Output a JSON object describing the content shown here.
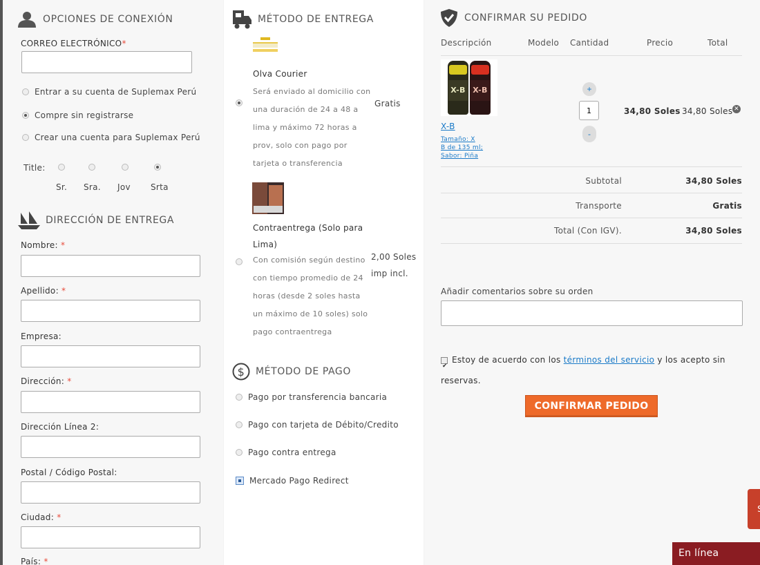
{
  "login": {
    "title": "OPCIONES DE CONEXIÓN",
    "email_label": "CORREO ELECTRÓNICO",
    "email_required": "*",
    "email_value": "",
    "options": [
      {
        "label": "Entrar a su cuenta de Suplemax Perú",
        "checked": false
      },
      {
        "label": "Compre sin registrarse",
        "checked": true
      },
      {
        "label": "Crear una cuenta para Suplemax Perú",
        "checked": false
      }
    ],
    "title_label": "Title:",
    "titles": [
      {
        "label": "Sr.",
        "checked": false
      },
      {
        "label": "Sra.",
        "checked": false
      },
      {
        "label": "Jov",
        "checked": false
      },
      {
        "label": "Srta",
        "checked": true
      }
    ]
  },
  "address": {
    "title": "DIRECCIÓN DE ENTREGA",
    "fields": [
      {
        "label": "Nombre:",
        "required": "*"
      },
      {
        "label": "Apellido:",
        "required": "*"
      },
      {
        "label": "Empresa:",
        "required": ""
      },
      {
        "label": "Dirección:",
        "required": "*"
      },
      {
        "label": "Dirección Línea 2:",
        "required": ""
      },
      {
        "label": "Postal / Código Postal:",
        "required": ""
      },
      {
        "label": "Ciudad:",
        "required": "*"
      },
      {
        "label": "País:",
        "required": "*"
      }
    ]
  },
  "shipping": {
    "title": "MÉTODO DE ENTREGA",
    "methods": [
      {
        "name": "Olva Courier",
        "lines": [
          "Será enviado al domicilio con",
          "una duración de 24 a 48 a",
          "lima y máximo 72 horas a",
          "prov, solo con pago por",
          "tarjeta o transferencia"
        ],
        "price_1": "Gratis",
        "price_2": "",
        "checked": true
      },
      {
        "name_1": "Contraentrega (Solo para",
        "name_2": "Lima)",
        "lines": [
          "Con comisión según destino",
          "con tiempo promedio de 24",
          "horas (desde 2 soles hasta",
          "un máximo de 10 soles) solo",
          "pago contraentrega"
        ],
        "price_1": "2,00 Soles",
        "price_2": "imp incl.",
        "checked": false
      }
    ]
  },
  "payment": {
    "title": "MÉTODO DE PAGO",
    "methods": [
      {
        "label": "Pago por transferencia bancaria",
        "checked": false
      },
      {
        "label": "Pago con tarjeta de Débito/Credito",
        "checked": false
      },
      {
        "label": "Pago contra entrega",
        "checked": false
      },
      {
        "label": "Mercado Pago Redirect",
        "checked": true
      }
    ]
  },
  "order": {
    "title": "CONFIRMAR SU PEDIDO",
    "headers": {
      "description": "Descripción",
      "model": "Modelo",
      "quantity": "Cantidad",
      "price": "Precio",
      "total": "Total"
    },
    "item": {
      "name": "X-B",
      "attr_1": "Tamaño: X",
      "attr_2": "B de 135 ml;",
      "attr_3": "Sabor: Piña",
      "qty_plus": "+",
      "qty_minus": "-",
      "qty": "1",
      "price": "34,80 Soles",
      "total": "34,80 Soles",
      "label_left": "X-B",
      "label_right": "X-B"
    },
    "subtotal_label": "Subtotal",
    "subtotal_value": "34,80 Soles",
    "transport_label": "Transporte",
    "transport_value": "Gratis",
    "grand_label": "Total (Con IGV).",
    "grand_value": "34,80 Soles",
    "comments_label": "Añadir comentarios sobre su orden",
    "terms_pre": "Estoy de acuerdo con los",
    "terms_link": "términos del servicio",
    "terms_post": "y los acepto sin",
    "terms_end": "reservas.",
    "terms_checked": true,
    "confirm_label": "CONFIRMAR PEDIDO"
  },
  "chat": {
    "label": "En línea",
    "side_letter": "S"
  },
  "colors": {
    "accent": "#ee6a2a",
    "link": "#1a7ac8",
    "chat": "#8a1c22"
  }
}
